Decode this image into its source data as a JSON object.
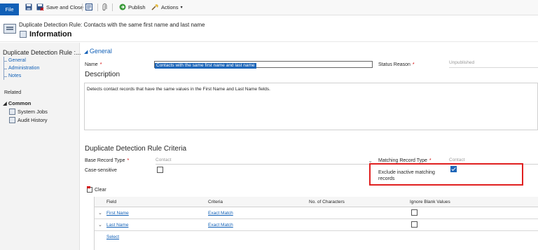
{
  "ribbon": {
    "file": "File",
    "save_and_close": "Save and Close",
    "publish": "Publish",
    "actions": "Actions"
  },
  "header": {
    "record_title": "Duplicate Detection Rule: Contacts with the same first name and last name",
    "form_name": "Information"
  },
  "nav": {
    "title": "Duplicate Detection Rule :...",
    "items": [
      "General",
      "Administration",
      "Notes"
    ],
    "related": "Related",
    "common": "Common",
    "common_items": [
      "System Jobs",
      "Audit History"
    ]
  },
  "form": {
    "section_general": "General",
    "name_label": "Name",
    "required_mark": "*",
    "name_value": "Contacts with the same first name and last name",
    "status_reason_label": "Status Reason",
    "status_reason_value": "Unpublished",
    "description_heading": "Description",
    "description_text": "Detects contact records that have the same values in the First Name and Last Name fields.",
    "criteria_heading": "Duplicate Detection Rule Criteria",
    "base_record_type_label": "Base Record Type",
    "base_record_type_value": "Contact",
    "matching_record_type_label": "Matching Record Type",
    "matching_record_type_value": "Contact",
    "case_sensitive_label": "Case-sensitive",
    "case_sensitive_checked": false,
    "exclude_inactive_label": "Exclude inactive matching records",
    "exclude_inactive_checked": true
  },
  "grid": {
    "clear": "Clear",
    "columns": [
      "Field",
      "Criteria",
      "No. of Characters",
      "Ignore Blank Values"
    ],
    "rows": [
      {
        "field": "First Name",
        "criteria": "Exact Match",
        "ignore_blank": false
      },
      {
        "field": "Last Name",
        "criteria": "Exact Match",
        "ignore_blank": false
      }
    ],
    "select": "Select"
  },
  "colors": {
    "accent": "#1160b7",
    "required": "#d20000",
    "highlight_border": "#e02020"
  }
}
